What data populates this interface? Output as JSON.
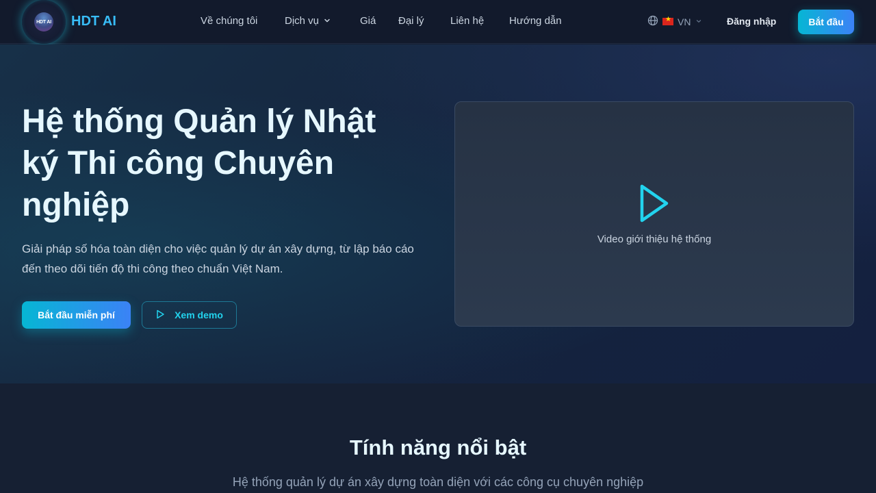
{
  "header": {
    "logo_text": "HDT AI",
    "brand": "HDT AI",
    "nav": [
      {
        "label": "Về chúng tôi"
      },
      {
        "label": "Dịch vụ"
      },
      {
        "label": "Giá"
      },
      {
        "label": "Đại lý"
      },
      {
        "label": "Liên hệ"
      },
      {
        "label": "Hướng dẫn"
      }
    ],
    "language": "VN",
    "login_label": "Đăng nhập",
    "start_label": "Bắt đầu"
  },
  "hero": {
    "title": "Hệ thống Quản lý Nhật ký Thi công Chuyên nghiệp",
    "subtitle": "Giải pháp số hóa toàn diện cho việc quản lý dự án xây dựng, từ lập báo cáo đến theo dõi tiến độ thi công theo chuẩn Việt Nam.",
    "primary_button": "Bắt đầu miễn phí",
    "demo_button": "Xem demo",
    "video_label": "Video giới thiệu hệ thống"
  },
  "features": {
    "title": "Tính năng nổi bật",
    "subtitle": "Hệ thống quản lý dự án xây dựng toàn diện với các công cụ chuyên nghiệp"
  },
  "colors": {
    "accent": "#22d3ee",
    "brand": "#38bdf8",
    "gradient_start": "#06b6d4",
    "gradient_end": "#3b82f6"
  },
  "icons": {
    "nav_dropdown": "chevron-down-icon",
    "language": "globe-icon",
    "language_dropdown": "chevron-down-icon",
    "demo": "play-icon",
    "video": "play-icon"
  }
}
